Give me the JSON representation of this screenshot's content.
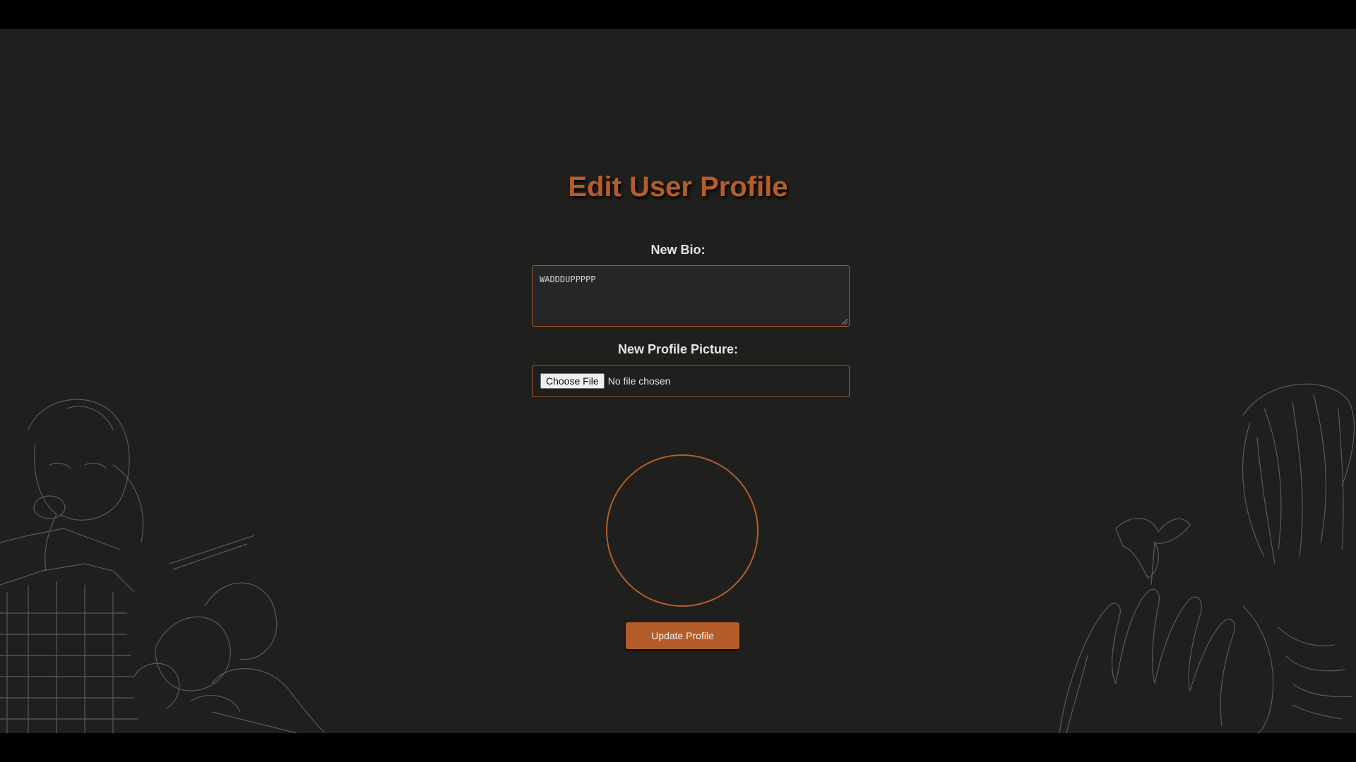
{
  "page": {
    "title": "Edit User Profile"
  },
  "form": {
    "bio_label": "New Bio:",
    "bio_value": "WADDDUPPPPP",
    "picture_label": "New Profile Picture:",
    "choose_file_label": "Choose File",
    "file_status": "No file chosen",
    "submit_label": "Update Profile"
  },
  "colors": {
    "accent": "#b55d2a",
    "background": "#1f1f1e",
    "label_text": "#e6e6e6"
  }
}
